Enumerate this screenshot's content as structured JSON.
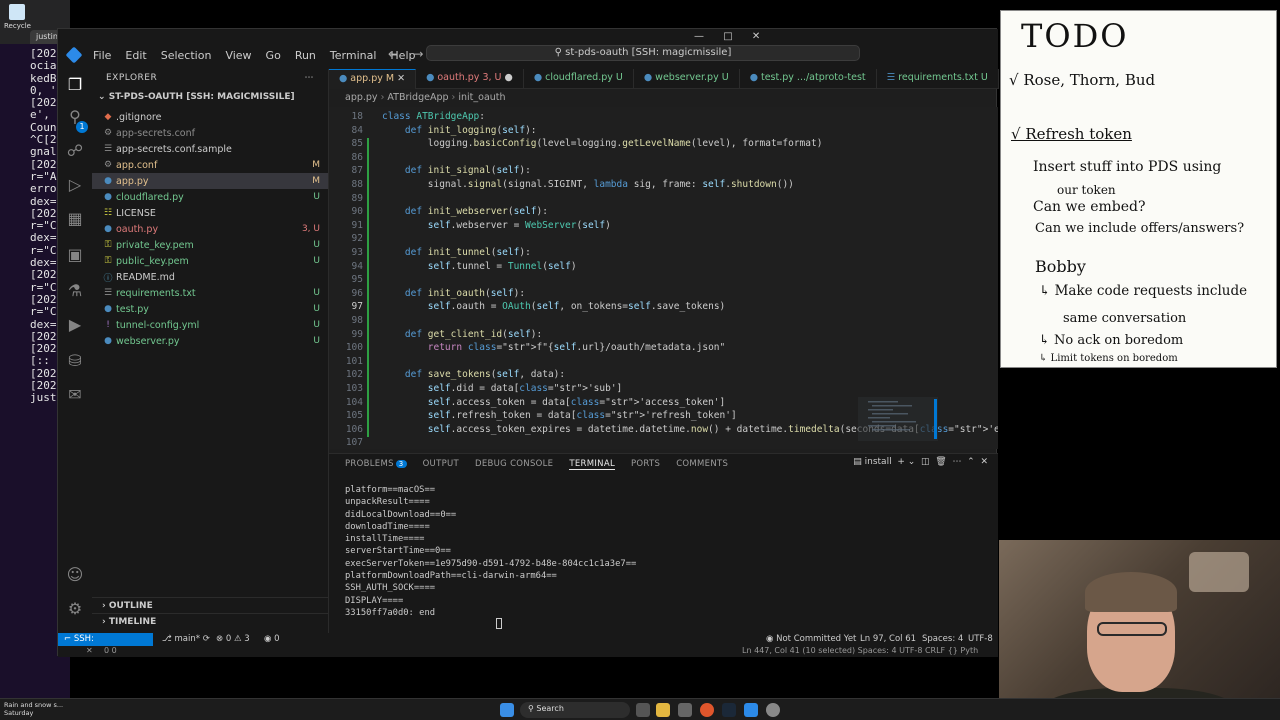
{
  "desktop": {
    "recycle_label": "Recycle",
    "browser_tab": "justin@porcupine: ~",
    "terminal_lines": [
      "[202",
      "ocia",
      "kedB",
      "0, '",
      "[202",
      "e', ",
      "Coun",
      "^C[2",
      "gnal",
      "[202",
      "r=\"A",
      "erro",
      "dex=",
      "[202",
      "r=\"C",
      "dex=",
      "r=\"C",
      "dex=",
      "[202",
      "r=\"C",
      "[202",
      "r=\"C",
      "dex=",
      "[202",
      "[202",
      "[::",
      "[202",
      "[202",
      "just"
    ]
  },
  "vscode": {
    "menu": [
      "File",
      "Edit",
      "Selection",
      "View",
      "Go",
      "Run",
      "Terminal",
      "Help"
    ],
    "command_center": "st-pds-oauth [SSH: magicmissile]",
    "explorer": {
      "title": "EXPLORER",
      "root": "ST-PDS-OAUTH [SSH: MAGICMISSILE]",
      "files": [
        {
          "name": ".gitignore",
          "status": "",
          "kind": "plain",
          "icon": "git-icon"
        },
        {
          "name": "app-secrets.conf",
          "status": "",
          "kind": "ignored",
          "icon": "gear-icon"
        },
        {
          "name": "app-secrets.conf.sample",
          "status": "",
          "kind": "plain",
          "icon": "file-icon"
        },
        {
          "name": "app.conf",
          "status": "M",
          "kind": "mod",
          "icon": "gear-icon"
        },
        {
          "name": "app.py",
          "status": "M",
          "kind": "mod",
          "icon": "python-icon"
        },
        {
          "name": "cloudflared.py",
          "status": "U",
          "kind": "untracked",
          "icon": "python-icon"
        },
        {
          "name": "LICENSE",
          "status": "",
          "kind": "plain",
          "icon": "license-icon"
        },
        {
          "name": "oauth.py",
          "status": "3, U",
          "kind": "err",
          "icon": "python-icon"
        },
        {
          "name": "private_key.pem",
          "status": "U",
          "kind": "untracked",
          "icon": "key-icon"
        },
        {
          "name": "public_key.pem",
          "status": "U",
          "kind": "untracked",
          "icon": "key-icon"
        },
        {
          "name": "README.md",
          "status": "",
          "kind": "plain",
          "icon": "info-icon"
        },
        {
          "name": "requirements.txt",
          "status": "U",
          "kind": "untracked",
          "icon": "file-icon"
        },
        {
          "name": "test.py",
          "status": "U",
          "kind": "untracked",
          "icon": "python-icon"
        },
        {
          "name": "tunnel-config.yml",
          "status": "U",
          "kind": "untracked",
          "icon": "yaml-icon"
        },
        {
          "name": "webserver.py",
          "status": "U",
          "kind": "untracked",
          "icon": "python-icon"
        }
      ],
      "outline": "OUTLINE",
      "timeline": "TIMELINE"
    },
    "tabs": [
      {
        "label": "app.py",
        "status": "M",
        "active": true
      },
      {
        "label": "oauth.py",
        "status": "3, U",
        "active": false
      },
      {
        "label": "cloudflared.py",
        "status": "U",
        "active": false
      },
      {
        "label": "webserver.py",
        "status": "U",
        "active": false
      },
      {
        "label": "test.py",
        "status": ".../atproto-test",
        "active": false
      },
      {
        "label": "requirements.txt",
        "status": "U",
        "active": false
      }
    ],
    "breadcrumb": [
      "app.py",
      "ATBridgeApp",
      "init_oauth"
    ],
    "editor_lines": [
      {
        "n": "18",
        "text": "class ATBridgeApp:"
      },
      {
        "n": "84",
        "text": "    def init_logging(self):"
      },
      {
        "n": "85",
        "text": "        logging.basicConfig(level=logging.getLevelName(level), format=format)"
      },
      {
        "n": "86",
        "text": ""
      },
      {
        "n": "87",
        "text": "    def init_signal(self):"
      },
      {
        "n": "88",
        "text": "        signal.signal(signal.SIGINT, lambda sig, frame: self.shutdown())"
      },
      {
        "n": "89",
        "text": ""
      },
      {
        "n": "90",
        "text": "    def init_webserver(self):"
      },
      {
        "n": "91",
        "text": "        self.webserver = WebServer(self)"
      },
      {
        "n": "92",
        "text": ""
      },
      {
        "n": "93",
        "text": "    def init_tunnel(self):"
      },
      {
        "n": "94",
        "text": "        self.tunnel = Tunnel(self)"
      },
      {
        "n": "95",
        "text": ""
      },
      {
        "n": "96",
        "text": "    def init_oauth(self):"
      },
      {
        "n": "97",
        "text": "        self.oauth = OAuth(self, on_tokens=self.save_tokens)"
      },
      {
        "n": "98",
        "text": ""
      },
      {
        "n": "99",
        "text": "    def get_client_id(self):"
      },
      {
        "n": "100",
        "text": "        return f\"{self.url}/oauth/metadata.json\""
      },
      {
        "n": "101",
        "text": ""
      },
      {
        "n": "102",
        "text": "    def save_tokens(self, data):"
      },
      {
        "n": "103",
        "text": "        self.did = data['sub']"
      },
      {
        "n": "104",
        "text": "        self.access_token = data['access_token']"
      },
      {
        "n": "105",
        "text": "        self.refresh_token = data['refresh_token']"
      },
      {
        "n": "106",
        "text": "        self.access_token_expires = datetime.datetime.now() + datetime.timedelta(seconds=data['expires_in'])"
      },
      {
        "n": "107",
        "text": ""
      }
    ],
    "panel": {
      "tabs": [
        "PROBLEMS",
        "OUTPUT",
        "DEBUG CONSOLE",
        "TERMINAL",
        "PORTS",
        "COMMENTS"
      ],
      "problems_count": "3",
      "active_tab": "TERMINAL",
      "terminal_name": "install",
      "terminal_lines": [
        "platform==macOS==",
        "unpackResult====",
        "didLocalDownload==0==",
        "downloadTime====",
        "installTime====",
        "serverStartTime==0==",
        "execServerToken==1e975d90-d591-4792-b48e-804cc1c1a3e7==",
        "platformDownloadPath==cli-darwin-arm64==",
        "SSH_AUTH_SOCK====",
        "DISPLAY====",
        "33150ff7a0d0: end"
      ]
    },
    "statusbar": {
      "remote": "SSH: magicmissile",
      "branch": "main*",
      "errors": "0",
      "warnings": "3",
      "ports": "0",
      "commit": "Not Committed Yet",
      "position": "Ln 97, Col 61",
      "spaces": "Spaces: 4",
      "encoding": "UTF-8",
      "status2_left": "0 0",
      "status2_right": "Ln 447, Col 41 (10 selected)   Spaces: 4   UTF-8   CRLF   {} Pyth"
    }
  },
  "todo_note": {
    "title": "TODO",
    "lines": [
      "√ Rose, Thorn, Bud",
      "√ Refresh token",
      "Insert stuff into PDS using",
      "our token",
      "Can we embed?",
      "Can we include offers/answers?",
      "Bobby",
      "↳ Make code requests include",
      "same conversation",
      "↳ No ack on boredom",
      "↳ Limit tokens on boredom"
    ]
  },
  "taskbar": {
    "weather_line1": "Rain and snow s...",
    "weather_line2": "Saturday",
    "search_placeholder": "Search"
  }
}
